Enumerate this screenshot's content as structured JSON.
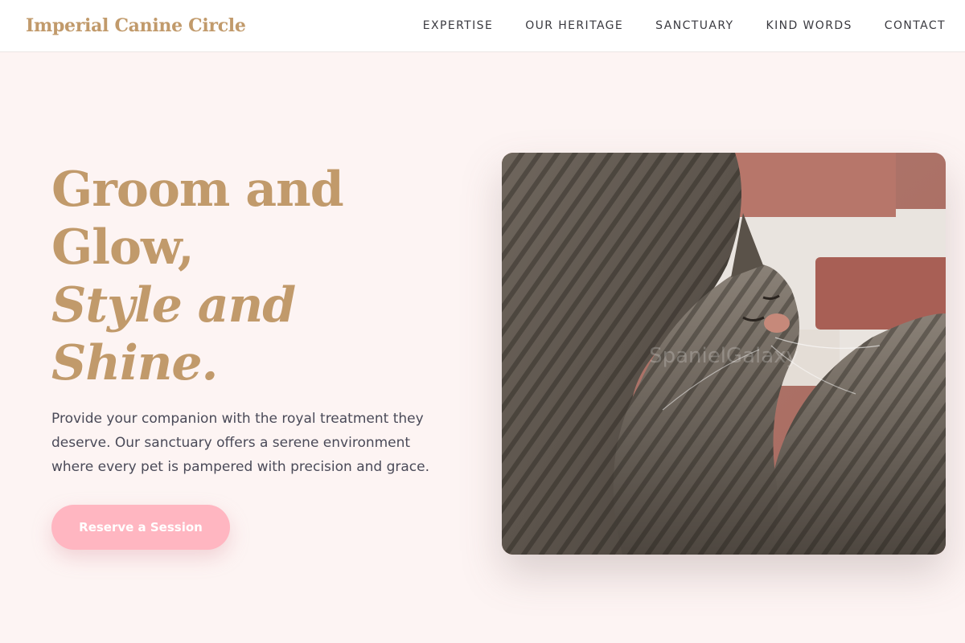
{
  "brand": {
    "name": "Imperial Canine Circle"
  },
  "nav": {
    "items": [
      {
        "label": "EXPERTISE"
      },
      {
        "label": "OUR HERITAGE"
      },
      {
        "label": "SANCTUARY"
      },
      {
        "label": "KIND WORDS"
      },
      {
        "label": "CONTACT"
      }
    ]
  },
  "hero": {
    "headline_line1": "Groom and",
    "headline_line2": "Glow,",
    "headline_line3": "Style and",
    "headline_line4": "Shine.",
    "description": "Provide your companion with the royal treatment they deserve. Our sanctuary offers a serene environment where every pet is pampered with precision and grace.",
    "cta_label": "Reserve a Session",
    "image_watermark": "SpanielGalaxy"
  },
  "colors": {
    "accent_gold": "#c19a6b",
    "cta_pink": "#ffb6c1",
    "page_background": "#fdf4f3"
  }
}
